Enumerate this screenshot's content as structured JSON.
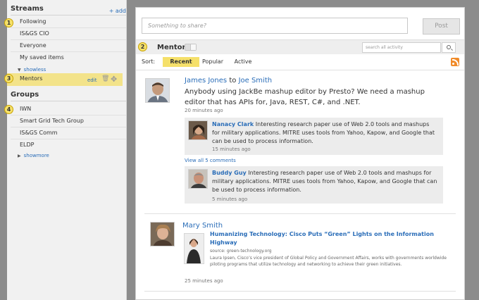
{
  "sidebar": {
    "streams_title": "Streams",
    "add_label": "+ add",
    "streams": [
      "Following",
      "IS&GS CIO",
      "Everyone",
      "My saved items"
    ],
    "showless_label": "showless",
    "active_item": {
      "label": "Mentors",
      "edit_label": "edit"
    },
    "groups_title": "Groups",
    "groups": [
      "IWN",
      "Smart Grid Tech Group",
      "IS&GS Comm",
      "ELDP"
    ],
    "showmore_label": "showmore",
    "badges": [
      "1",
      "3",
      "4"
    ]
  },
  "main": {
    "share_placeholder": "Something to share?",
    "post_label": "Post",
    "stream_title": "Mentors",
    "stream_badge": "2",
    "search_placeholder": "search all activity",
    "sort_label": "Sort:",
    "sort_tabs": [
      "Recent",
      "Popular",
      "Active"
    ],
    "active_sort": "Recent"
  },
  "feed": [
    {
      "author": "James Jones",
      "to_word": "to",
      "recipient": "Joe Smith",
      "text": "Anybody using JackBe mashup editor by Presto? We need a mashup editor that has APIs for, Java, REST, C#, and .NET.",
      "time": "20 minutes ago",
      "comments": [
        {
          "author": "Nanacy Clark",
          "text": "Interesting research paper use of Web 2.0 tools and mashups for military applications. MITRE uses tools from Yahoo, Kapow, and Google that can be used to process information.",
          "time": "15 minutes ago"
        },
        {
          "author": "Buddy Guy",
          "text": "Interesting research paper use of Web 2.0 tools and mashups for military applications. MITRE uses tools from Yahoo, Kapow, and Google that can be used to process information.",
          "time": "5 minutes ago"
        }
      ],
      "view_all_label": "View all 5 comments"
    },
    {
      "author": "Mary Smith",
      "link_title": "Humanizing Technology: Cisco Puts “Green” Lights on the Information Highway",
      "source": "source: green-technology.org",
      "description": "Laura Ipsen, Cisco’s vice president of Global Policy and Government Affairs, works with governments worldwide piloting programs that utilize technology and networking to achieve their green initiatives.",
      "time": "25 minutes ago"
    }
  ],
  "colors": {
    "highlight": "#f3e38a",
    "link": "#2a6db8",
    "badge": "#f5e06a",
    "rss": "#f08b2a"
  }
}
